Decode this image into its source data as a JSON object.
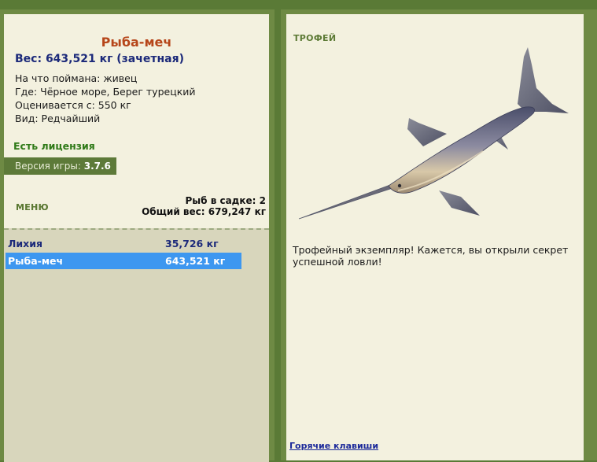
{
  "fish": {
    "name": "Рыба-меч",
    "weight_line": "Вес: 643,521 кг (зачетная)",
    "bait": "На что поймана: живец",
    "location": "Где: Чёрное море, Берег турецкий",
    "rated_from": "Оценивается с: 550 кг",
    "kind": "Вид: Редчайший"
  },
  "license": "Есть лицензия",
  "version": {
    "label": "Версия игры:",
    "value": "3.7.6"
  },
  "menu_label": "МЕНЮ",
  "keep": {
    "count_line": "Рыб в садке: 2",
    "total_line": "Общий вес: 679,247 кг"
  },
  "catch_list": [
    {
      "name": "Лихия",
      "weight": "35,726 кг",
      "selected": false
    },
    {
      "name": "Рыба-меч",
      "weight": "643,521 кг",
      "selected": true
    }
  ],
  "trophy": {
    "label": "ТРОФЕЙ",
    "text": "Трофейный экземпляр! Кажется, вы открыли секрет успешной ловли!"
  },
  "hotkeys_link": "Горячие клавиши",
  "colors": {
    "background": "#5a7a36",
    "panel": "#f3f1df",
    "title": "#b6461a",
    "weight": "#1c2a7a",
    "license": "#2f7a18",
    "selection": "#3d97f0"
  }
}
